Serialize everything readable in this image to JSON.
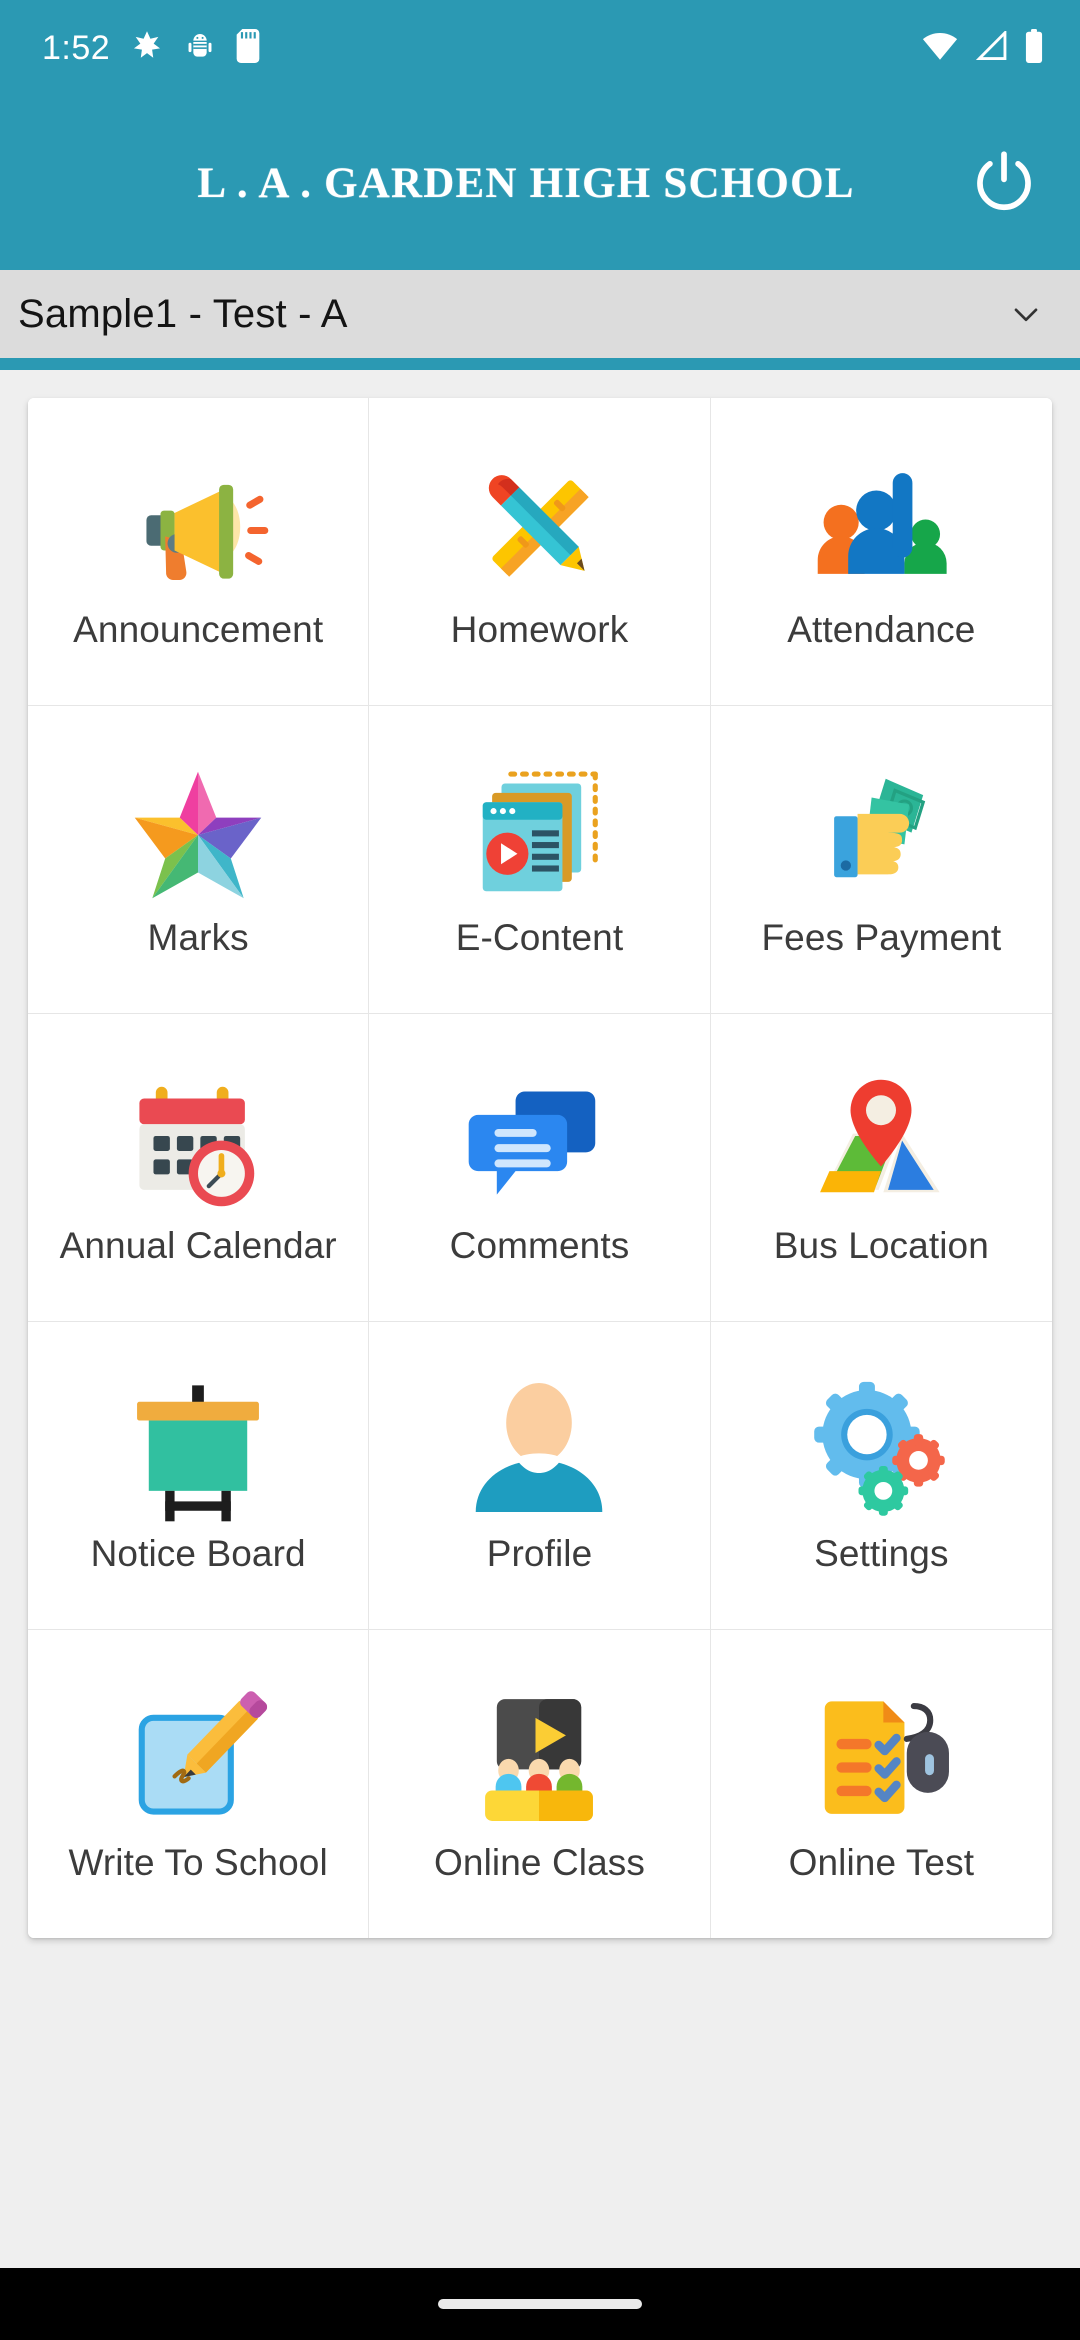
{
  "statusbar": {
    "time": "1:52",
    "left_icons": [
      "burst-star-icon",
      "android-bug-icon",
      "sd-card-icon"
    ],
    "right_icons": [
      "wifi-icon",
      "signal-icon",
      "battery-icon"
    ],
    "background_color": "#2b99b3",
    "foreground_color": "#ffffff"
  },
  "appbar": {
    "title": "L . A . GARDEN HIGH SCHOOL",
    "power_icon": "power-icon",
    "background_color": "#2b99b3",
    "title_color": "#ffffff"
  },
  "class_selector": {
    "value": "Sample1 - Test - A",
    "caret_icon": "chevron-down-icon",
    "background_color": "#dcdcdc",
    "text_color": "#141414"
  },
  "accent_rule_color": "#2b99b3",
  "page_background": "#efefef",
  "grid": {
    "columns": 3,
    "tiles": [
      {
        "label": "Announcement",
        "icon": "megaphone-icon"
      },
      {
        "label": "Homework",
        "icon": "pencil-ruler-icon"
      },
      {
        "label": "Attendance",
        "icon": "people-raised-hand-icon"
      },
      {
        "label": "Marks",
        "icon": "multicolor-star-icon"
      },
      {
        "label": "E-Content",
        "icon": "media-documents-icon"
      },
      {
        "label": "Fees Payment",
        "icon": "hand-cash-icon"
      },
      {
        "label": "Annual Calendar",
        "icon": "calendar-clock-icon"
      },
      {
        "label": "Comments",
        "icon": "chat-bubbles-icon"
      },
      {
        "label": "Bus Location",
        "icon": "map-pin-icon"
      },
      {
        "label": "Notice Board",
        "icon": "notice-board-icon"
      },
      {
        "label": "Profile",
        "icon": "person-avatar-icon"
      },
      {
        "label": "Settings",
        "icon": "gears-icon"
      },
      {
        "label": "Write To School",
        "icon": "compose-pencil-icon"
      },
      {
        "label": "Online Class",
        "icon": "blackboard-students-icon"
      },
      {
        "label": "Online Test",
        "icon": "checklist-mouse-icon"
      }
    ]
  },
  "navbar": {
    "gesture_pill": "home-gesture-pill",
    "background_color": "#000000"
  }
}
